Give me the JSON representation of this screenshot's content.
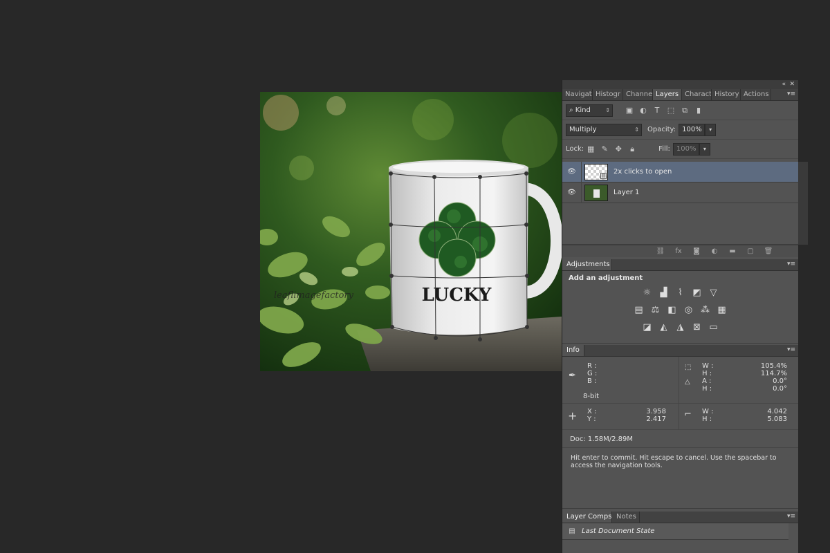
{
  "panel_top": {
    "collapse_icon": "double-chevron-icon",
    "close_icon": "close-icon"
  },
  "tabs_top": [
    {
      "label": "Navigat",
      "active": false
    },
    {
      "label": "Histogr",
      "active": false
    },
    {
      "label": "Channel",
      "active": false
    },
    {
      "label": "Layers",
      "active": true
    },
    {
      "label": "Charact",
      "active": false
    },
    {
      "label": "History",
      "active": false
    },
    {
      "label": "Actions",
      "active": false
    }
  ],
  "layers": {
    "filter_kind": "Kind",
    "blend_mode": "Multiply",
    "opacity_label": "Opacity:",
    "opacity_value": "100%",
    "lock_label": "Lock:",
    "fill_label": "Fill:",
    "fill_value": "100%",
    "items": [
      {
        "name": "2x clicks to open",
        "selected": true,
        "visible": true
      },
      {
        "name": "Layer 1",
        "selected": false,
        "visible": true
      }
    ]
  },
  "adjustments": {
    "tab_label": "Adjustments",
    "title": "Add an adjustment"
  },
  "info": {
    "tab_label": "Info",
    "rgb_labels": "R :\nG :\nB :",
    "bit_depth": "8-bit",
    "transform_labels": "W :\nH :\nA :\nH :",
    "transform_values": "105.4%\n114.7%\n0.0°\n0.0°",
    "xy_labels": "X :\nY :",
    "xy_values": "3.958\n2.417",
    "wh_labels": "W :\nH :",
    "wh_values": "4.042\n5.083",
    "doc": "Doc: 1.58M/2.89M",
    "hint": "Hit enter to commit. Hit escape to cancel. Use the spacebar to\naccess the navigation tools."
  },
  "bottom_tabs": [
    {
      "label": "Layer Comps",
      "active": true
    },
    {
      "label": "Notes",
      "active": false
    }
  ],
  "layer_comps": {
    "item": "Last Document State"
  },
  "canvas": {
    "mug_text": "LUCKY",
    "watermark": "leaflimagefactory"
  }
}
